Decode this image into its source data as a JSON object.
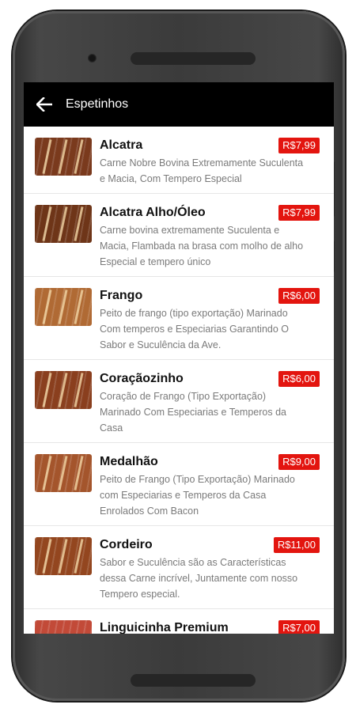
{
  "appbar": {
    "title": "Espetinhos",
    "back_icon": "arrow-back-icon"
  },
  "colors": {
    "appbar_bg": "#000000",
    "price_bg": "#e3150f"
  },
  "items": [
    {
      "name": "Alcatra",
      "price": "R$7,99",
      "desc": [
        "Carne Nobre Bovina Extremamente Suculenta",
        "e Macia, Com Tempero Especial"
      ]
    },
    {
      "name": "Alcatra Alho/Óleo",
      "price": "R$7,99",
      "desc": [
        "Carne bovina extremamente Suculenta e",
        "Macia, Flambada na brasa com molho de alho",
        "Especial e tempero único"
      ]
    },
    {
      "name": "Frango",
      "price": "R$6,00",
      "desc": [
        "Peito de frango (tipo exportação) Marinado",
        "Com temperos e Especiarias Garantindo O",
        "Sabor e Suculência da Ave."
      ]
    },
    {
      "name": "Coraçãozinho",
      "price": "R$6,00",
      "desc": [
        "Coração de Frango (Tipo Exportação)",
        "Marinado Com  Especiarias e Temperos da",
        "Casa"
      ]
    },
    {
      "name": "Medalhão",
      "price": "R$9,00",
      "desc": [
        "Peito de Frango (Tipo Exportação) Marinado",
        "com Especiarias e Temperos da Casa",
        "Enrolados Com Bacon"
      ]
    },
    {
      "name": "Cordeiro",
      "price": "R$11,00",
      "desc": [
        "Sabor e Suculência são as Características",
        "dessa Carne incrível, Juntamente com nosso",
        "Tempero especial."
      ]
    },
    {
      "name": "Linguicinha Premium",
      "price": "R$7,00",
      "desc": []
    }
  ]
}
